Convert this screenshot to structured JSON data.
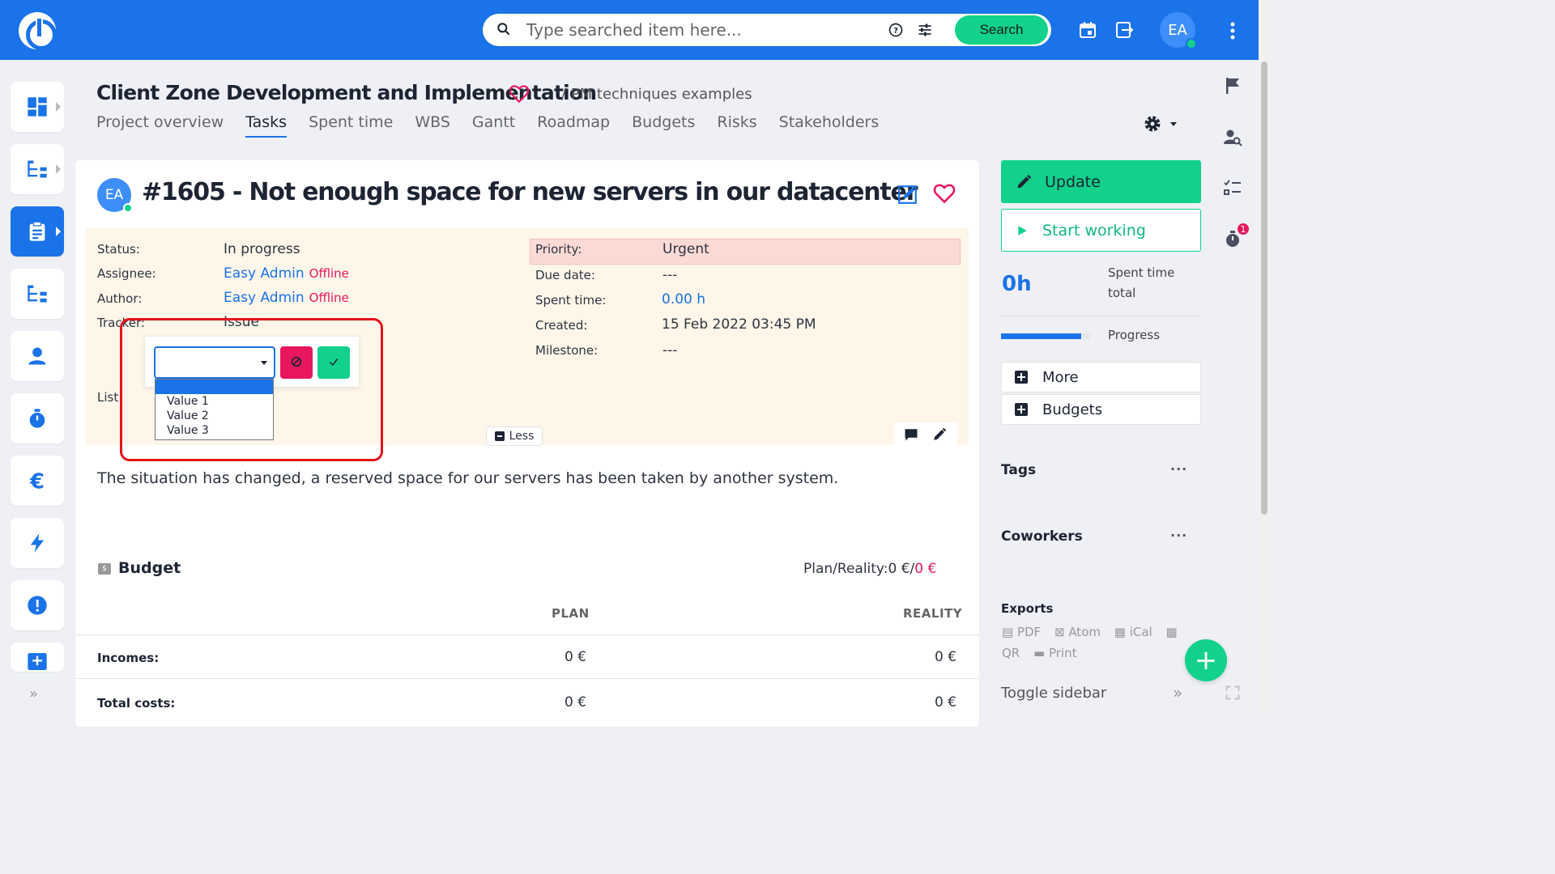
{
  "search": {
    "placeholder": "Type searched item here...",
    "button": "Search"
  },
  "user": {
    "initials": "EA"
  },
  "project": {
    "title": "Client Zone Development and Implementation",
    "breadcrumb": "/ PM techniques examples",
    "tabs": [
      "Project overview",
      "Tasks",
      "Spent time",
      "WBS",
      "Gantt",
      "Roadmap",
      "Budgets",
      "Risks",
      "Stakeholders"
    ],
    "active_tab": "Tasks"
  },
  "issue": {
    "avatar": "EA",
    "title": "#1605 - Not enough space for new servers in our datacenter",
    "attributes_left": {
      "status_label": "Status:",
      "status_value": "In progress",
      "assignee_label": "Assignee:",
      "assignee_value": "Easy Admin",
      "assignee_state": "Offline",
      "author_label": "Author:",
      "author_value": "Easy Admin",
      "author_state": "Offline",
      "tracker_label": "Tracker:",
      "tracker_value": "Issue",
      "list_label": "List:"
    },
    "attributes_right": {
      "priority_label": "Priority:",
      "priority_value": "Urgent",
      "due_label": "Due date:",
      "due_value": "---",
      "spent_label": "Spent time:",
      "spent_value": "0.00 h",
      "created_label": "Created:",
      "created_value": "15 Feb 2022 03:45 PM",
      "milestone_label": "Milestone:",
      "milestone_value": "---"
    },
    "less_button": "Less",
    "dropdown_options": [
      "Value 1",
      "Value 2",
      "Value 3"
    ],
    "description": "The situation has changed, a reserved space for our servers has been taken by another system."
  },
  "budget": {
    "title": "Budget",
    "plan_reality_label": "Plan/Reality:",
    "plan_value": "0 €",
    "reality_value": "0 €",
    "col_plan": "PLAN",
    "col_reality": "REALITY",
    "rows": [
      {
        "label": "Incomes:",
        "plan": "0 €",
        "reality": "0 €"
      },
      {
        "label": "Total costs:",
        "plan": "0 €",
        "reality": "0 €"
      }
    ]
  },
  "sidebar_right": {
    "update": "Update",
    "start": "Start working",
    "spent_value": "0h",
    "spent_label": "Spent time total",
    "progress_label": "Progress",
    "progress_fraction": 0.9,
    "more": "More",
    "budgets": "Budgets",
    "tags": "Tags",
    "coworkers": "Coworkers",
    "exports": "Exports",
    "export_links": [
      "PDF",
      "Atom",
      "iCal",
      "QR",
      "Print"
    ],
    "toggle": "Toggle sidebar",
    "timer_badge": "1"
  },
  "colors": {
    "brand": "#1a73e8",
    "success": "#11d18b",
    "danger": "#e8175d"
  }
}
